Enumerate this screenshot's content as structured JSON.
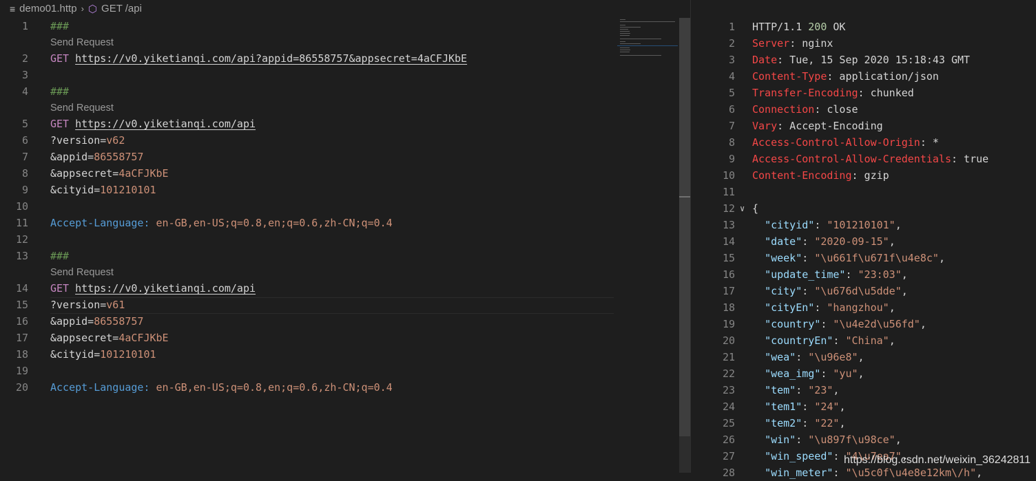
{
  "breadcrumb": {
    "file": "demo01.http",
    "symbol": "GET /api"
  },
  "codelens_label": "Send Request",
  "left_lines": [
    {
      "n": "1",
      "kind": "comment",
      "text": "###",
      "lens": true
    },
    {
      "n": "2",
      "kind": "request",
      "method": "GET",
      "url": "https://v0.yiketianqi.com/api?appid=86558757&appsecret=4aCFJKbE"
    },
    {
      "n": "3",
      "kind": "blank"
    },
    {
      "n": "4",
      "kind": "comment",
      "text": "###",
      "lens": true
    },
    {
      "n": "5",
      "kind": "request",
      "method": "GET",
      "url": "https://v0.yiketianqi.com/api"
    },
    {
      "n": "6",
      "kind": "param",
      "key": "?version=",
      "value": "v62"
    },
    {
      "n": "7",
      "kind": "param",
      "key": "&appid=",
      "value": "86558757"
    },
    {
      "n": "8",
      "kind": "param",
      "key": "&appsecret=",
      "value": "4aCFJKbE"
    },
    {
      "n": "9",
      "kind": "param",
      "key": "&cityid=",
      "value": "101210101"
    },
    {
      "n": "10",
      "kind": "blank"
    },
    {
      "n": "11",
      "kind": "header",
      "key": "Accept-Language:",
      "value": " en-GB,en-US;q=0.8,en;q=0.6,zh-CN;q=0.4"
    },
    {
      "n": "12",
      "kind": "blank"
    },
    {
      "n": "13",
      "kind": "comment",
      "text": "###",
      "lens": true
    },
    {
      "n": "14",
      "kind": "request",
      "method": "GET",
      "url": "https://v0.yiketianqi.com/api"
    },
    {
      "n": "15",
      "kind": "param",
      "key": "?version=",
      "value": "v61",
      "current": true
    },
    {
      "n": "16",
      "kind": "param",
      "key": "&appid=",
      "value": "86558757"
    },
    {
      "n": "17",
      "kind": "param",
      "key": "&appsecret=",
      "value": "4aCFJKbE"
    },
    {
      "n": "18",
      "kind": "param",
      "key": "&cityid=",
      "value": "101210101"
    },
    {
      "n": "19",
      "kind": "blank"
    },
    {
      "n": "20",
      "kind": "header",
      "key": "Accept-Language:",
      "value": " en-GB,en-US;q=0.8,en;q=0.6,zh-CN;q=0.4"
    }
  ],
  "response_lines": [
    {
      "n": "1",
      "kind": "status",
      "proto": "HTTP/1.1 ",
      "code": "200",
      "reason": " OK"
    },
    {
      "n": "2",
      "kind": "rheader",
      "key": "Server",
      "value": ": nginx"
    },
    {
      "n": "3",
      "kind": "rheader",
      "key": "Date",
      "value": ": Tue, 15 Sep 2020 15:18:43 GMT"
    },
    {
      "n": "4",
      "kind": "rheader",
      "key": "Content-Type",
      "value": ": application/json"
    },
    {
      "n": "5",
      "kind": "rheader",
      "key": "Transfer-Encoding",
      "value": ": chunked"
    },
    {
      "n": "6",
      "kind": "rheader",
      "key": "Connection",
      "value": ": close"
    },
    {
      "n": "7",
      "kind": "rheader",
      "key": "Vary",
      "value": ": Accept-Encoding"
    },
    {
      "n": "8",
      "kind": "rheader",
      "key": "Access-Control-Allow-Origin",
      "value": ": *"
    },
    {
      "n": "9",
      "kind": "rheader",
      "key": "Access-Control-Allow-Credentials",
      "value": ": true"
    },
    {
      "n": "10",
      "kind": "rheader",
      "key": "Content-Encoding",
      "value": ": gzip"
    },
    {
      "n": "11",
      "kind": "blank"
    },
    {
      "n": "12",
      "kind": "brace",
      "text": "{",
      "fold": true
    },
    {
      "n": "13",
      "kind": "json",
      "key": "\"cityid\"",
      "value": "\"101210101\""
    },
    {
      "n": "14",
      "kind": "json",
      "key": "\"date\"",
      "value": "\"2020-09-15\""
    },
    {
      "n": "15",
      "kind": "json",
      "key": "\"week\"",
      "value": "\"\\u661f\\u671f\\u4e8c\""
    },
    {
      "n": "16",
      "kind": "json",
      "key": "\"update_time\"",
      "value": "\"23:03\""
    },
    {
      "n": "17",
      "kind": "json",
      "key": "\"city\"",
      "value": "\"\\u676d\\u5dde\""
    },
    {
      "n": "18",
      "kind": "json",
      "key": "\"cityEn\"",
      "value": "\"hangzhou\""
    },
    {
      "n": "19",
      "kind": "json",
      "key": "\"country\"",
      "value": "\"\\u4e2d\\u56fd\""
    },
    {
      "n": "20",
      "kind": "json",
      "key": "\"countryEn\"",
      "value": "\"China\""
    },
    {
      "n": "21",
      "kind": "json",
      "key": "\"wea\"",
      "value": "\"\\u96e8\""
    },
    {
      "n": "22",
      "kind": "json",
      "key": "\"wea_img\"",
      "value": "\"yu\""
    },
    {
      "n": "23",
      "kind": "json",
      "key": "\"tem\"",
      "value": "\"23\""
    },
    {
      "n": "24",
      "kind": "json",
      "key": "\"tem1\"",
      "value": "\"24\""
    },
    {
      "n": "25",
      "kind": "json",
      "key": "\"tem2\"",
      "value": "\"22\""
    },
    {
      "n": "26",
      "kind": "json",
      "key": "\"win\"",
      "value": "\"\\u897f\\u98ce\""
    },
    {
      "n": "27",
      "kind": "json",
      "key": "\"win_speed\"",
      "value": "\"4\\u7ea7\""
    },
    {
      "n": "28",
      "kind": "json",
      "key": "\"win_meter\"",
      "value": "\"\\u5c0f\\u4e8e12km\\/h\""
    }
  ],
  "watermark": "https://blog.csdn.net/weixin_36242811",
  "colors": {
    "background": "#1e1e1e",
    "comment": "#6a9955",
    "method": "#c586c0",
    "header_key": "#569cd6",
    "string": "#ce9178",
    "json_key": "#9cdcfe",
    "status_code": "#b5cea8",
    "response_header": "#f44747"
  }
}
